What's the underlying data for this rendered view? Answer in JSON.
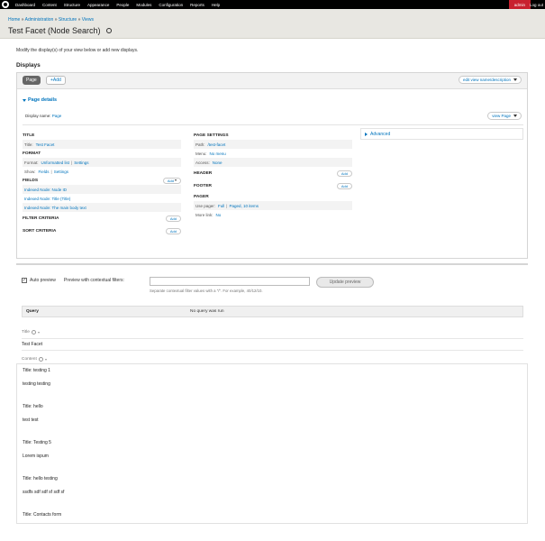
{
  "toolbar": {
    "items": [
      "Dashboard",
      "Content",
      "Structure",
      "Appearance",
      "People",
      "Modules",
      "Configuration",
      "Reports",
      "Help"
    ],
    "user": "admin",
    "logout": "Log out"
  },
  "breadcrumb": {
    "items": [
      "Home",
      "Administration",
      "Structure",
      "Views"
    ],
    "separator": "»"
  },
  "page_title": "Test Facet (Node Search)",
  "intro_text": "Modify the display(s) of your view below or add new displays.",
  "displays_heading": "Displays",
  "display_tab": "Page",
  "add_tab": "+Add",
  "edit_view_button": "edit view name/description",
  "section_title": "Page details",
  "display_name": {
    "label": "Display name:",
    "value": "Page"
  },
  "view_page_button": "view Page",
  "left_col": {
    "title_h": "TITLE",
    "title_row": {
      "label": "Title:",
      "value": "Test Facet"
    },
    "format_h": "FORMAT",
    "format_row": {
      "label": "Format:",
      "value": "Unformatted list",
      "sep": "|",
      "link": "Settings"
    },
    "show_row": {
      "label": "Show:",
      "value": "Fields",
      "sep": "|",
      "link": "Settings"
    },
    "fields_h": "FIELDS",
    "fields_add": "Add",
    "fields": [
      "Indexed Node: Node ID",
      "Indexed Node: Title (Title)",
      "Indexed Node: The main body text"
    ],
    "filter_h": "FILTER CRITERIA",
    "filter_add": "Add",
    "sort_h": "SORT CRITERIA",
    "sort_add": "Add"
  },
  "mid_col": {
    "page_settings_h": "PAGE SETTINGS",
    "path_row": {
      "label": "Path:",
      "value": "/test-facet"
    },
    "menu_row": {
      "label": "Menu:",
      "value": "No menu"
    },
    "access_row": {
      "label": "Access:",
      "value": "None"
    },
    "header_h": "HEADER",
    "header_add": "Add",
    "footer_h": "FOOTER",
    "footer_add": "Add",
    "pager_h": "PAGER",
    "pager_row": {
      "label": "Use pager:",
      "value": "Full",
      "sep": "|",
      "link": "Paged, 10 items"
    },
    "more_row": {
      "label": "More link:",
      "value": "No"
    }
  },
  "advanced": "Advanced",
  "preview": {
    "auto_label": "Auto preview",
    "contextual_label": "Preview with contextual filters:",
    "update_button": "Update preview",
    "hint": "Separate contextual filter values with a \"/\". For example, 40/12/10."
  },
  "query": {
    "label": "Query",
    "value": "No query was run"
  },
  "title_field": {
    "label": "Title",
    "value": "Test Facet"
  },
  "content_field": {
    "label": "Content"
  },
  "results": [
    {
      "title": "Title: testing 1",
      "body": "testing testing"
    },
    {
      "title": "Title: hello",
      "body": "test test"
    },
    {
      "title": "Title: Testing 5",
      "body": "Lorem ispum"
    },
    {
      "title": "Title: hello testing",
      "body": "ssdfs sdf sdf sf sdf sf"
    },
    {
      "title": "Title: Contacts form",
      "body": ""
    }
  ]
}
